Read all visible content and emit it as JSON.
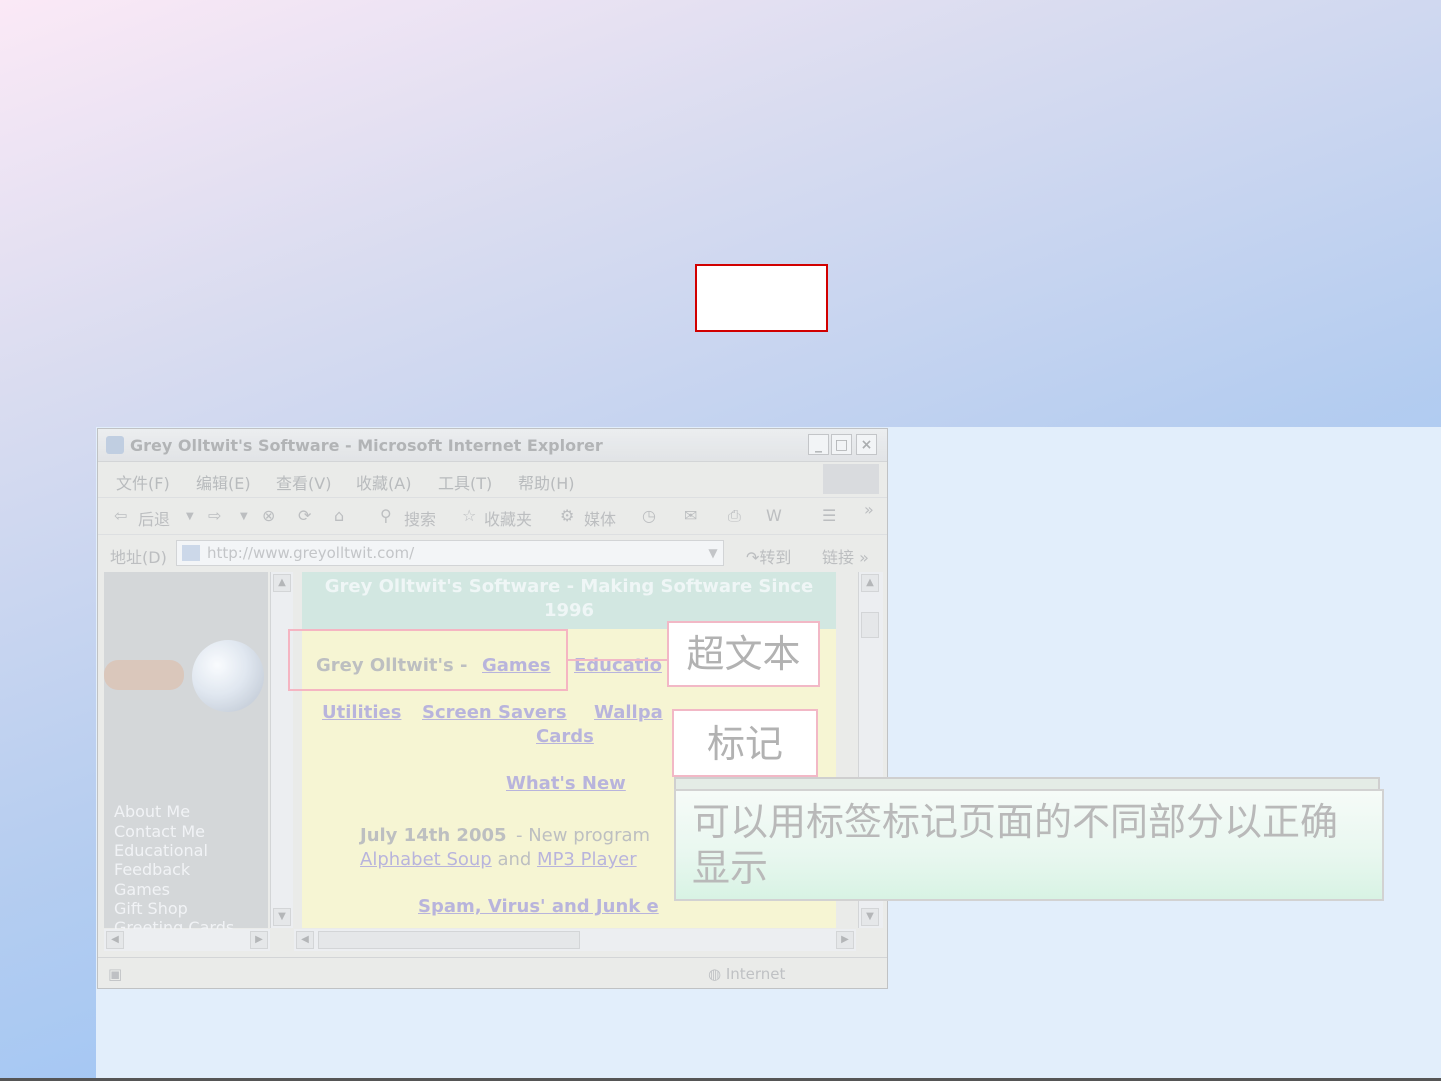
{
  "window": {
    "title": "Grey Olltwit's Software - Microsoft Internet Explorer",
    "controls": [
      "_",
      "□",
      "×"
    ]
  },
  "menu": [
    "文件(F)",
    "编辑(E)",
    "查看(V)",
    "收藏(A)",
    "工具(T)",
    "帮助(H)"
  ],
  "toolbar": {
    "back": "后退",
    "search": "搜索",
    "favorites": "收藏夹",
    "media": "媒体"
  },
  "address": {
    "label": "地址(D)",
    "url": "http://www.greyolltwit.com/",
    "go": "转到",
    "links": "链接"
  },
  "site": {
    "header": "Grey Olltwit's Software - Making Software Since 1996",
    "brand_prefix": "Grey Olltwit's - ",
    "games_link": "Games",
    "educational_link": "Educatio",
    "utilities": "Utilities",
    "screen_savers": "Screen Savers",
    "wallpapers": "Wallpa",
    "cards": "Cards",
    "whats_new": "What's New",
    "news_date": "July 14th 2005",
    "news_text": " - New program",
    "alphabet_soup": "Alphabet Soup",
    "and": " and ",
    "mp3_player": "MP3 Player",
    "spam_link": "Spam, Virus' and Junk e"
  },
  "sidebar_nav": [
    "About Me",
    "Contact Me",
    "Educational",
    "Feedback",
    "Games",
    "Gift Shop",
    "Greeting Cards"
  ],
  "status": {
    "zone": "Internet"
  },
  "callouts": {
    "hypertext": "超文本",
    "markup": "标记",
    "note": "可以用标签标记页面的不同部分以正确显示"
  }
}
